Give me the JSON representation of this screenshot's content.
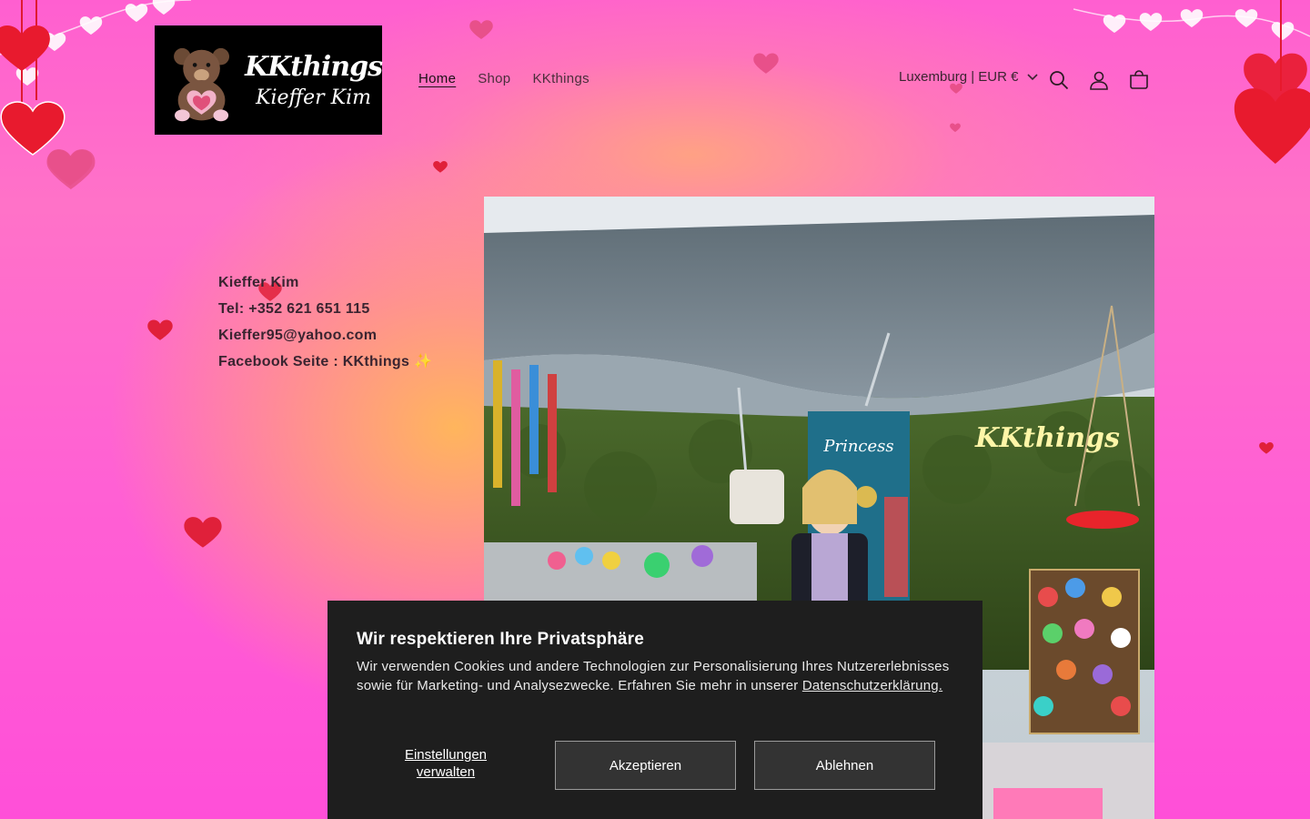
{
  "colors": {
    "background_pink": "#ff5fd0",
    "background_glow": "#ffbe50",
    "banner_bg": "#1e1e1e",
    "button_bg": "#333333",
    "heart_red": "#e0203a",
    "heart_pink": "#e8508a"
  },
  "header": {
    "logo": {
      "brand_top": "KKthings",
      "brand_bottom": "Kieffer Kim",
      "icon": "teddy-bear-icon"
    },
    "nav": [
      {
        "label": "Home",
        "active": true
      },
      {
        "label": "Shop",
        "active": false
      },
      {
        "label": "KKthings",
        "active": false
      }
    ],
    "locale": "Luxemburg | EUR €",
    "icons": {
      "search": "search-icon",
      "account": "account-icon",
      "cart": "cart-icon"
    }
  },
  "contact": {
    "name": "Kieffer Kim",
    "phone": "Tel: +352 621 651 115",
    "email": "Kieffer95@yahoo.com",
    "facebook": "Facebook Seite : KKthings",
    "facebook_emoji": "✨"
  },
  "photo": {
    "sign_princess": "Princess",
    "sign_neon": "KKthings"
  },
  "cookie_banner": {
    "title": "Wir respektieren Ihre Privatsphäre",
    "message": "Wir verwenden Cookies und andere Technologien zur Personalisierung Ihres Nutzererlebnisses sowie für Marketing- und Analysezwecke. Erfahren Sie mehr in unserer ",
    "policy_link": "Datenschutzerklärung.",
    "manage_label_1": "Einstellungen",
    "manage_label_2": "verwalten",
    "accept_label": "Akzeptieren",
    "decline_label": "Ablehnen"
  }
}
